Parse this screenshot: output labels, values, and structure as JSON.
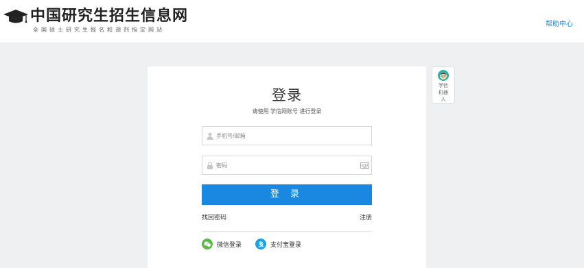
{
  "header": {
    "site_title": "中国研究生招生信息网",
    "site_subtitle": "全国硕士研究生报名和调剂指定网站",
    "help_link": "帮助中心"
  },
  "login": {
    "title": "登录",
    "description": "请使用 学信网账号 进行登录",
    "username_placeholder": "手机号/邮箱",
    "password_placeholder": "密码",
    "submit_label": "登 录",
    "forgot_password": "找回密码",
    "register": "注册",
    "wechat_login": "微信登录",
    "alipay_login": "支付宝登录"
  },
  "robot": {
    "label": "学信机器人"
  },
  "colors": {
    "primary": "#1a88e0",
    "page_background": "#eef0f2",
    "wechat_green": "#5fb84a",
    "alipay_blue": "#1aa1e8",
    "help_link": "#1e88e5"
  },
  "icons": {
    "logo": "graduation-cap-icon",
    "username": "user-icon",
    "password": "lock-icon",
    "keyboard": "keyboard-icon",
    "wechat": "wechat-icon",
    "alipay": "alipay-icon",
    "robot": "robot-avatar-icon"
  }
}
